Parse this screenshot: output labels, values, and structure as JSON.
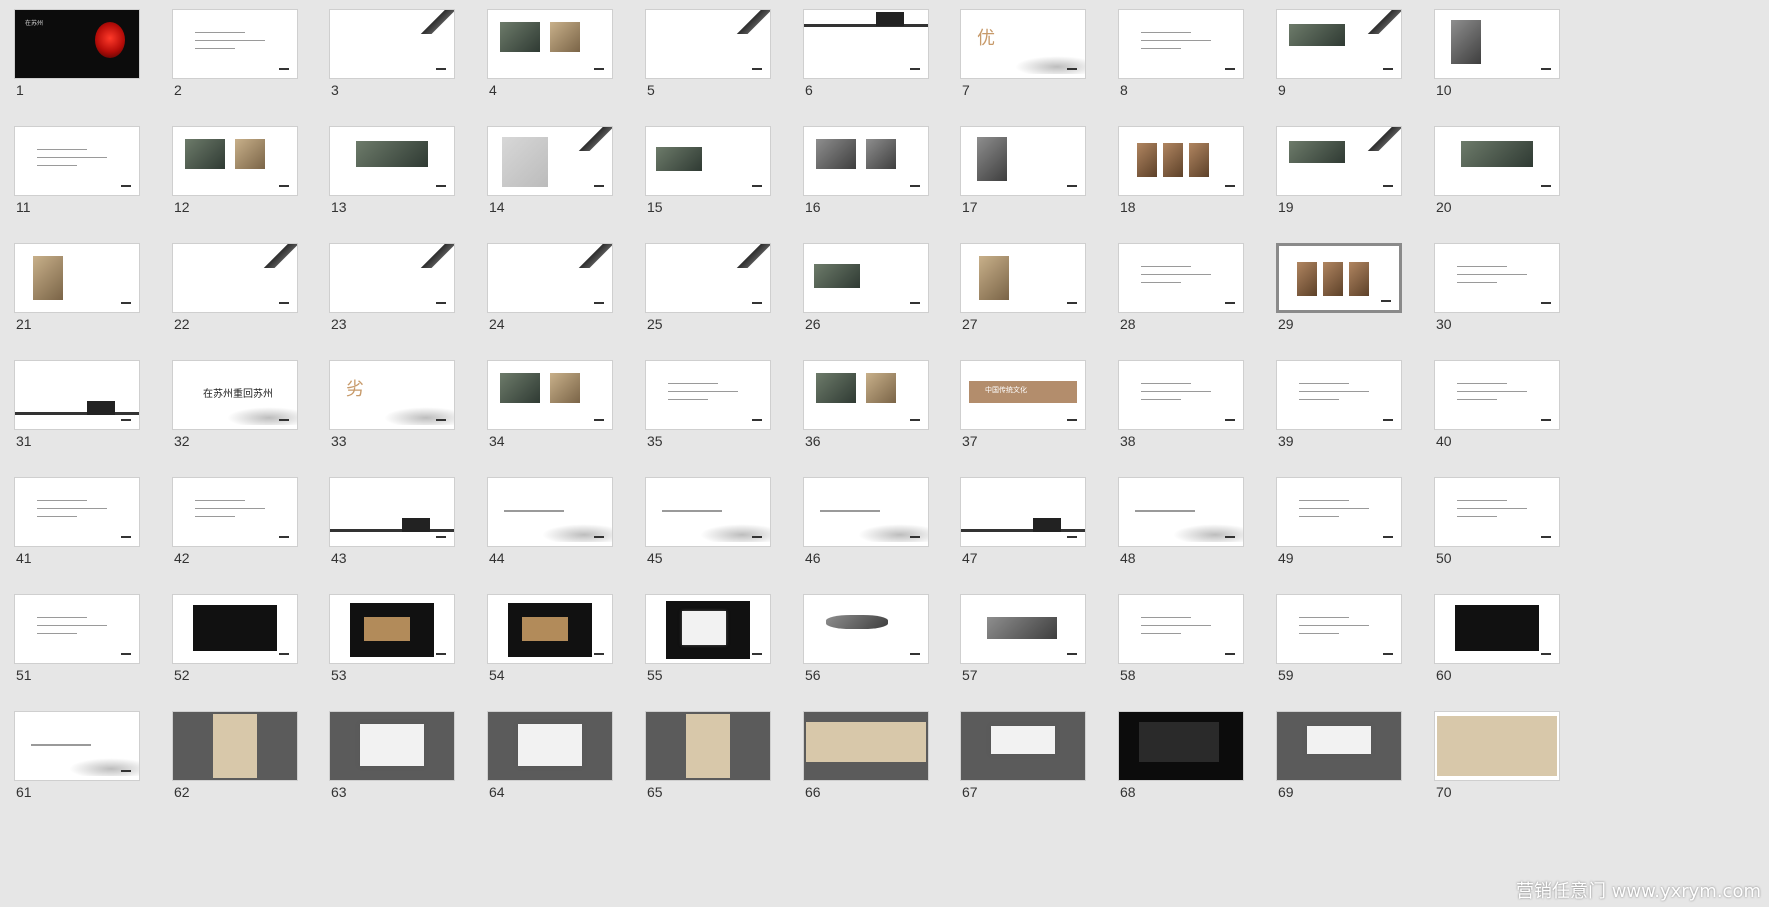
{
  "slides": [
    {
      "n": "1",
      "v": "dark-lantern"
    },
    {
      "n": "2",
      "v": "plain"
    },
    {
      "n": "3",
      "v": "eave"
    },
    {
      "n": "4",
      "v": "photo2"
    },
    {
      "n": "5",
      "v": "eave"
    },
    {
      "n": "6",
      "v": "wall-top"
    },
    {
      "n": "7",
      "v": "char"
    },
    {
      "n": "8",
      "v": "plain"
    },
    {
      "n": "9",
      "v": "photo-eave"
    },
    {
      "n": "10",
      "v": "portrait"
    },
    {
      "n": "11",
      "v": "plain"
    },
    {
      "n": "12",
      "v": "photo2"
    },
    {
      "n": "13",
      "v": "photo-wide"
    },
    {
      "n": "14",
      "v": "plan-eave"
    },
    {
      "n": "15",
      "v": "photo-left"
    },
    {
      "n": "16",
      "v": "photo2-gray"
    },
    {
      "n": "17",
      "v": "portrait"
    },
    {
      "n": "18",
      "v": "photo3"
    },
    {
      "n": "19",
      "v": "photo-eave"
    },
    {
      "n": "20",
      "v": "photo-wide"
    },
    {
      "n": "21",
      "v": "portrait-warm"
    },
    {
      "n": "22",
      "v": "eave"
    },
    {
      "n": "23",
      "v": "eave"
    },
    {
      "n": "24",
      "v": "eave"
    },
    {
      "n": "25",
      "v": "eave"
    },
    {
      "n": "26",
      "v": "photo-left"
    },
    {
      "n": "27",
      "v": "portrait-warm"
    },
    {
      "n": "28",
      "v": "plain"
    },
    {
      "n": "29",
      "v": "photo3-selected"
    },
    {
      "n": "30",
      "v": "plain"
    },
    {
      "n": "31",
      "v": "wall"
    },
    {
      "n": "32",
      "v": "title"
    },
    {
      "n": "33",
      "v": "char"
    },
    {
      "n": "34",
      "v": "photo2"
    },
    {
      "n": "35",
      "v": "plain"
    },
    {
      "n": "36",
      "v": "photo2"
    },
    {
      "n": "37",
      "v": "banner"
    },
    {
      "n": "38",
      "v": "plain"
    },
    {
      "n": "39",
      "v": "plain"
    },
    {
      "n": "40",
      "v": "plain"
    },
    {
      "n": "41",
      "v": "plain"
    },
    {
      "n": "42",
      "v": "plain"
    },
    {
      "n": "43",
      "v": "wall"
    },
    {
      "n": "44",
      "v": "mist"
    },
    {
      "n": "45",
      "v": "mist"
    },
    {
      "n": "46",
      "v": "mist"
    },
    {
      "n": "47",
      "v": "wall"
    },
    {
      "n": "48",
      "v": "mist"
    },
    {
      "n": "49",
      "v": "plain"
    },
    {
      "n": "50",
      "v": "plain"
    },
    {
      "n": "51",
      "v": "plain"
    },
    {
      "n": "52",
      "v": "black-logo"
    },
    {
      "n": "53",
      "v": "cards"
    },
    {
      "n": "54",
      "v": "cards"
    },
    {
      "n": "55",
      "v": "cards-white"
    },
    {
      "n": "56",
      "v": "wave"
    },
    {
      "n": "57",
      "v": "roof"
    },
    {
      "n": "58",
      "v": "plain"
    },
    {
      "n": "59",
      "v": "plain"
    },
    {
      "n": "60",
      "v": "black-logo"
    },
    {
      "n": "61",
      "v": "mist"
    },
    {
      "n": "62",
      "v": "grey-poster"
    },
    {
      "n": "63",
      "v": "grey-book"
    },
    {
      "n": "64",
      "v": "grey-book"
    },
    {
      "n": "65",
      "v": "grey-poster"
    },
    {
      "n": "66",
      "v": "grey-wide"
    },
    {
      "n": "67",
      "v": "grey-board"
    },
    {
      "n": "68",
      "v": "night"
    },
    {
      "n": "69",
      "v": "grey-board"
    },
    {
      "n": "70",
      "v": "wide-poster"
    }
  ],
  "watermark": "营销任意门 www.yxrym.com",
  "slide_texts": {
    "s1_title": "在苏州",
    "s7_char": "优",
    "s33_char": "劣",
    "s32_title": "在苏州重回苏州",
    "s37_banner": "中国传统文化"
  }
}
